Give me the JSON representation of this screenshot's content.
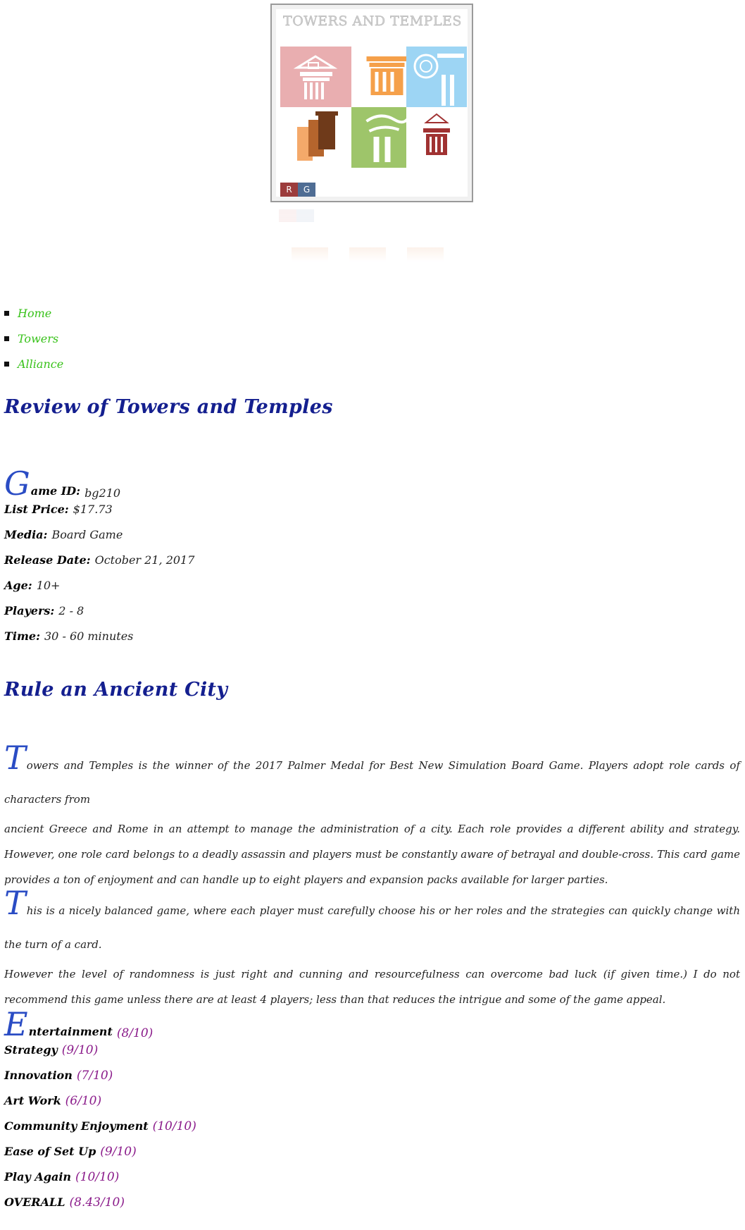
{
  "cover": {
    "title": "TOWERS AND TEMPLES",
    "badges": [
      "R",
      "G"
    ],
    "colors": {
      "pink": "#e9aeb0",
      "orange": "#f5a04a",
      "blue": "#9dd5f4",
      "brown": "#8a4a22",
      "green": "#9ec56a",
      "red": "#a03232"
    }
  },
  "nav": {
    "items": [
      {
        "label": "Home"
      },
      {
        "label": "Towers"
      },
      {
        "label": "Alliance"
      }
    ],
    "color": "#38c21a"
  },
  "review_title": "Review of Towers and Temples",
  "details": [
    {
      "label": "Game ID:",
      "value": "bg210"
    },
    {
      "label": "List Price:",
      "value": "$17.73"
    },
    {
      "label": "Media:",
      "value": "Board Game"
    },
    {
      "label": "Release Date:",
      "value": "October 21, 2017"
    },
    {
      "label": "Age:",
      "value": "10+"
    },
    {
      "label": "Players:",
      "value": "2 - 8"
    },
    {
      "label": "Time:",
      "value": "30 - 60 minutes"
    }
  ],
  "section_title": "Rule an Ancient City",
  "paragraphs": [
    {
      "first_line": "Towers and Temples is the winner of the 2017 Palmer Medal for Best New Simulation Board Game. Players adopt role cards of characters from",
      "rest": "ancient Greece and Rome in an attempt to manage the administration of a city. Each role provides a different ability and strategy. However, one role card belongs to a deadly assassin and players must be constantly aware of betrayal and double-cross. This card game provides a ton of enjoyment and can handle up to eight players and expansion packs available for larger parties."
    },
    {
      "first_line": "This is a nicely balanced game, where each player must carefully choose his or her roles and the strategies can quickly change with the turn of a card.",
      "rest": "However the level of randomness is just right and cunning and resourcefulness can overcome bad luck (if given time.) I do not recommend this game unless there are at least 4 players; less than that reduces the intrigue and some of the game appeal."
    }
  ],
  "ratings": [
    {
      "label": "Entertainment",
      "score": "(8/10)"
    },
    {
      "label": "Strategy",
      "score": "(9/10)"
    },
    {
      "label": "Innovation",
      "score": "(7/10)"
    },
    {
      "label": "Art Work",
      "score": "(6/10)"
    },
    {
      "label": "Community Enjoyment",
      "score": "(10/10)"
    },
    {
      "label": "Ease of Set Up",
      "score": "(9/10)"
    },
    {
      "label": "Play Again",
      "score": "(10/10)"
    },
    {
      "label": "OVERALL",
      "score": "(8.43/10)"
    }
  ]
}
